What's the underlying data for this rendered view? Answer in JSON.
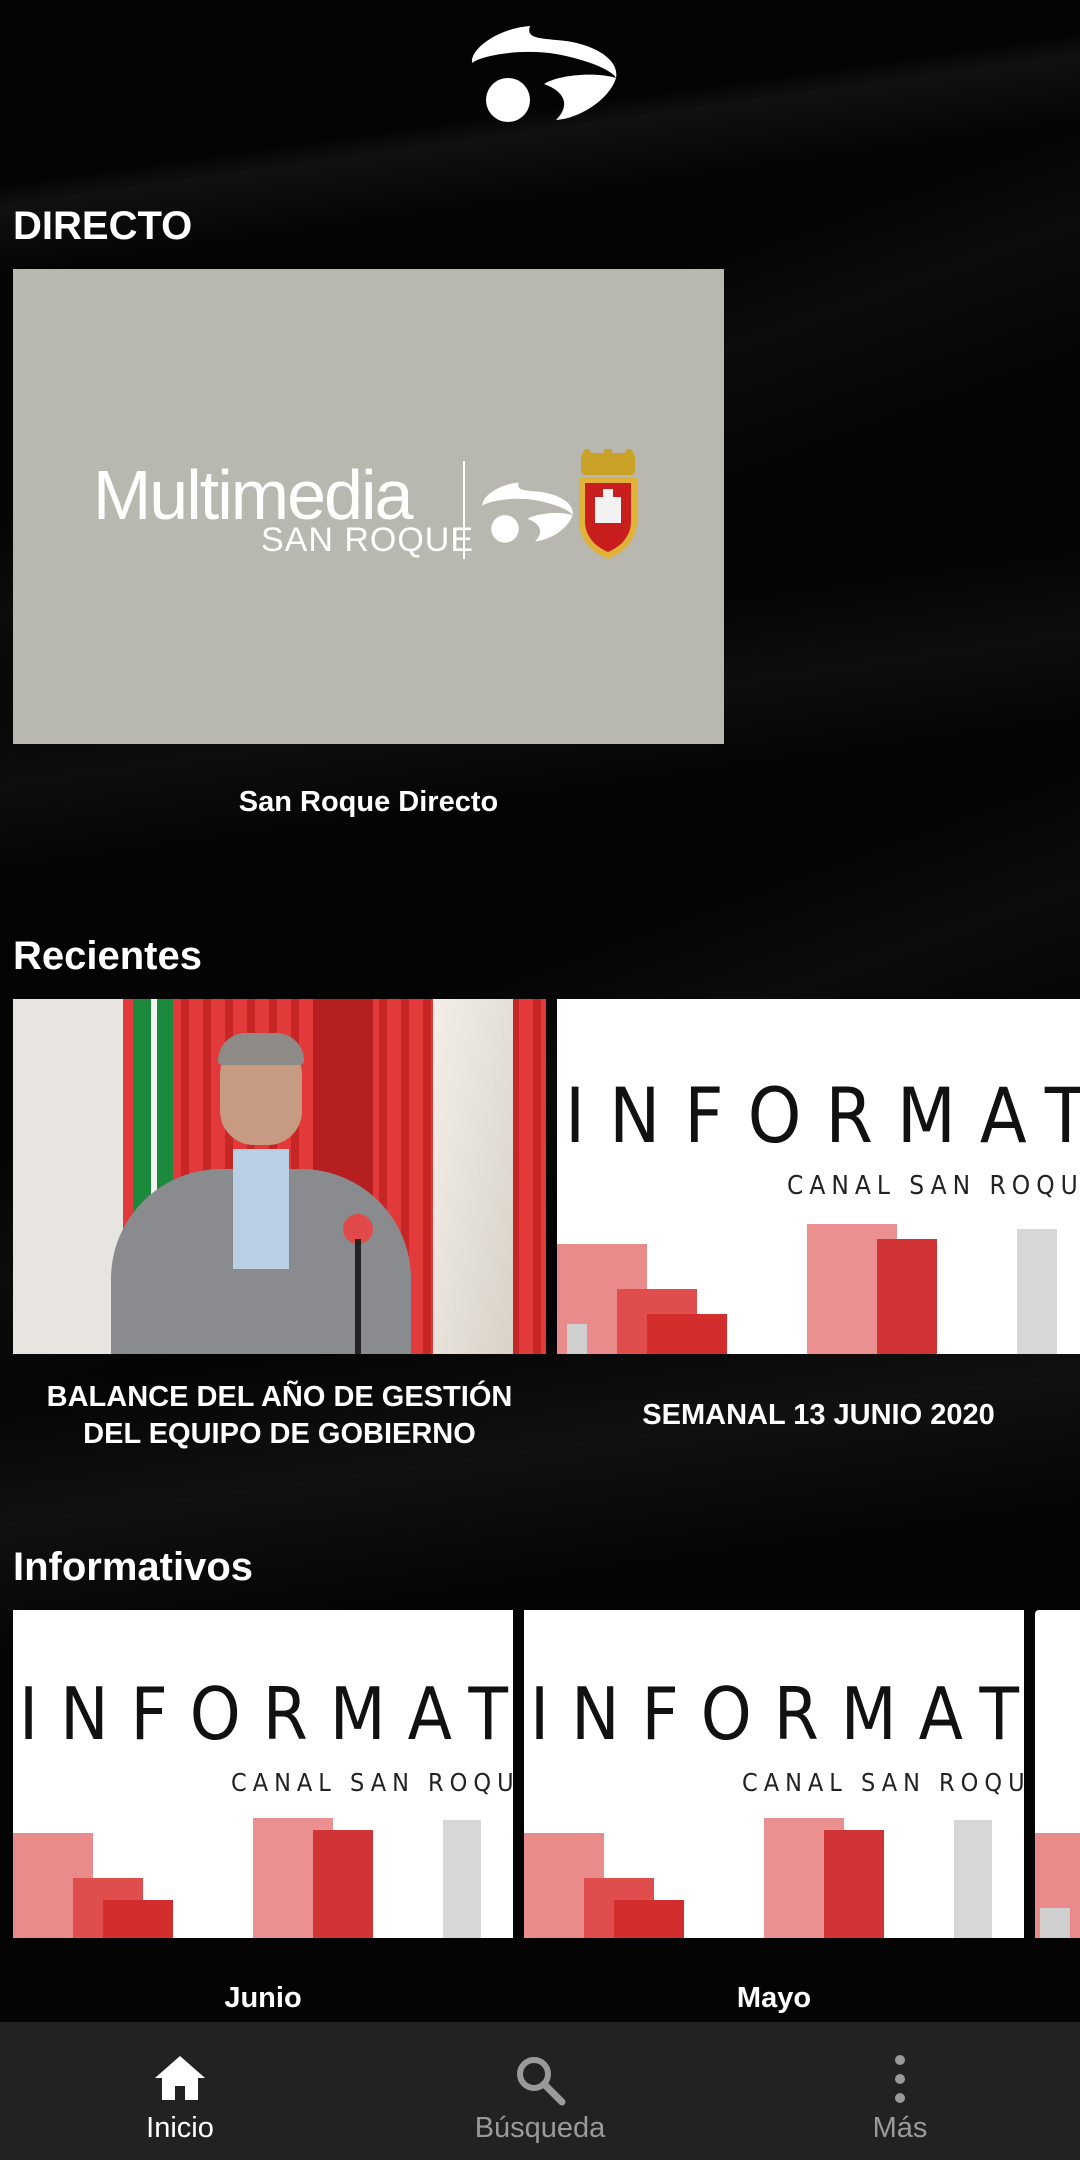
{
  "app": {
    "logo_icon": "multimedia-swoosh-logo"
  },
  "sections": {
    "directo": {
      "title": "DIRECTO",
      "live": {
        "caption": "San Roque Directo",
        "brand_main": "Multimedia",
        "brand_sub": "SAN ROQUE"
      }
    },
    "recientes": {
      "title": "Recientes",
      "items": [
        {
          "caption_line1": "BALANCE DEL AÑO DE GESTIÓN",
          "caption_line2": "DEL EQUIPO DE GOBIERNO"
        },
        {
          "caption_line1": "SEMANAL 13 JUNIO 2020",
          "caption_line2": "",
          "thumb_title": "INFORMATIVOS",
          "thumb_sub": "CANAL SAN ROQUE RTVM"
        }
      ]
    },
    "informativos": {
      "title": "Informativos",
      "items": [
        {
          "caption": "Junio",
          "thumb_title": "INFORMATIVOS",
          "thumb_sub": "CANAL SAN ROQUE RTVM"
        },
        {
          "caption": "Mayo",
          "thumb_title": "INFORMATIVOS",
          "thumb_sub": "CANAL SAN ROQUE RTVM"
        }
      ]
    }
  },
  "bottom_nav": {
    "items": [
      {
        "label": "Inicio",
        "icon": "home-icon",
        "active": true
      },
      {
        "label": "Búsqueda",
        "icon": "search-icon",
        "active": false
      },
      {
        "label": "Más",
        "icon": "more-vertical-icon",
        "active": false
      }
    ]
  },
  "colors": {
    "background": "#040404",
    "nav_background": "#222222",
    "brand_red": "#d42a2a",
    "live_card_bg": "#b8b7b0"
  }
}
